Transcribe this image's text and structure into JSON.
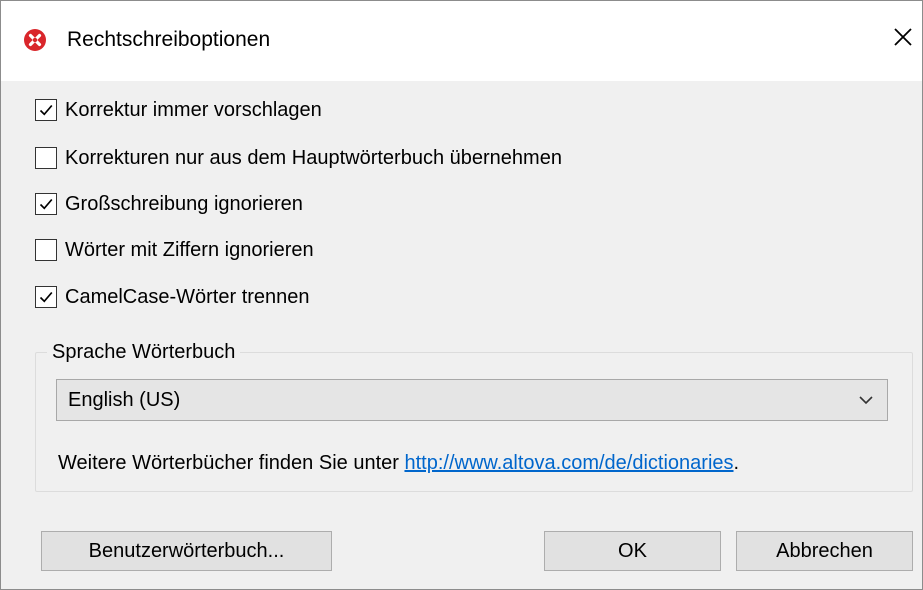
{
  "window": {
    "title": "Rechtschreiboptionen",
    "icon": "altova-red-x-icon",
    "close_icon": "close-icon"
  },
  "options": [
    {
      "label": "Korrektur immer vorschlagen",
      "checked": true
    },
    {
      "label": "Korrekturen nur aus dem Hauptwörterbuch übernehmen",
      "checked": false
    },
    {
      "label": "Großschreibung ignorieren",
      "checked": true
    },
    {
      "label": "Wörter mit Ziffern ignorieren",
      "checked": false
    },
    {
      "label": "CamelCase-Wörter trennen",
      "checked": true
    }
  ],
  "dictionary": {
    "group_label": "Sprache Wörterbuch",
    "selected": "English (US)",
    "info_text": "Weitere Wörterbücher finden Sie unter ",
    "link_text": "http://www.altova.com/de/dictionaries",
    "info_suffix": "."
  },
  "buttons": {
    "user_dictionary": "Benutzerwörterbuch...",
    "ok": "OK",
    "cancel": "Abbrechen"
  },
  "colors": {
    "link": "#0066cc",
    "icon_red": "#d9262b",
    "dialog_bg": "#f0f0f0",
    "button_bg": "#e1e1e1"
  }
}
